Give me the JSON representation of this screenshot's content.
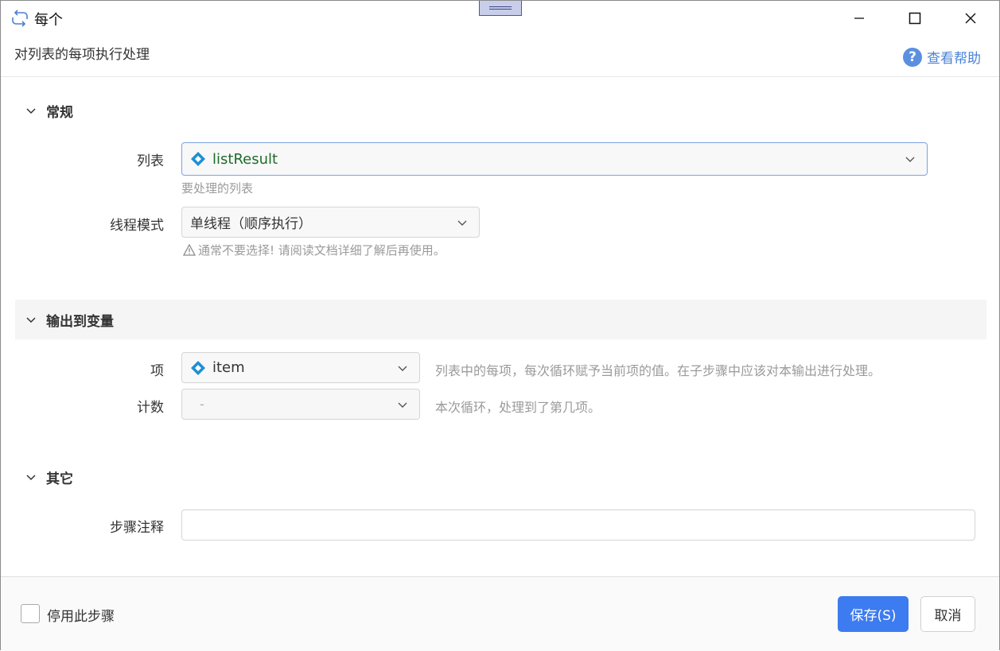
{
  "window": {
    "title": "每个",
    "subtitle": "对列表的每项执行处理",
    "help_label": "查看帮助",
    "controls": [
      "minimize",
      "maximize",
      "close"
    ]
  },
  "sections": {
    "general": {
      "title": "常规",
      "list": {
        "label": "列表",
        "value": "listResult",
        "hint": "要处理的列表"
      },
      "thread_mode": {
        "label": "线程模式",
        "value": "单线程（顺序执行）",
        "hint": "通常不要选择! 请阅读文档详细了解后再使用。"
      }
    },
    "output": {
      "title": "输出到变量",
      "item": {
        "label": "项",
        "value": "item",
        "hint": "列表中的每项，每次循环赋予当前项的值。在子步骤中应该对本输出进行处理。"
      },
      "count": {
        "label": "计数",
        "value": "-",
        "hint": "本次循环，处理到了第几项。"
      }
    },
    "other": {
      "title": "其它",
      "comment": {
        "label": "步骤注释",
        "value": ""
      }
    }
  },
  "footer": {
    "disable_label": "停用此步骤",
    "disable_checked": false,
    "save_label": "保存(S)",
    "cancel_label": "取消"
  },
  "colors": {
    "accent": "#3d7bf0",
    "variable_icon": "#1e8fd6",
    "variable_text": "#1c6b2c",
    "help_link": "#4a82d8"
  },
  "icons": {
    "title": "loop-icon",
    "help": "question-circle-icon",
    "variable": "diamond-variable-icon",
    "warning": "warning-triangle-icon"
  }
}
